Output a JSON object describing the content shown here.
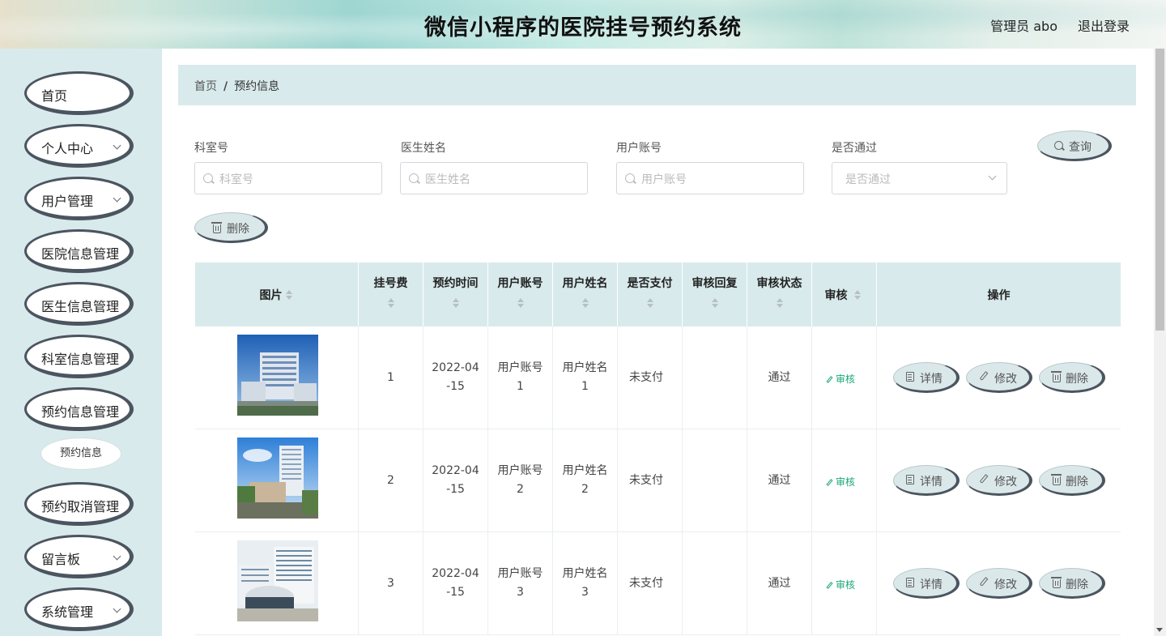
{
  "header": {
    "title": "微信小程序的医院挂号预约系统",
    "user": "管理员 abo",
    "logout": "退出登录"
  },
  "sidebar": {
    "items": [
      {
        "label": "首页",
        "has_arrow": false
      },
      {
        "label": "个人中心",
        "has_arrow": true
      },
      {
        "label": "用户管理",
        "has_arrow": true
      },
      {
        "label": "医院信息管理",
        "has_arrow": false
      },
      {
        "label": "医生信息管理",
        "has_arrow": false
      },
      {
        "label": "科室信息管理",
        "has_arrow": false
      },
      {
        "label": "预约信息管理",
        "has_arrow": false
      },
      {
        "label": "预约取消管理",
        "has_arrow": false
      },
      {
        "label": "留言板",
        "has_arrow": true
      },
      {
        "label": "系统管理",
        "has_arrow": true
      }
    ],
    "sub_item": "预约信息"
  },
  "breadcrumb": {
    "home": "首页",
    "separator": "/",
    "current": "预约信息"
  },
  "search": {
    "fields": [
      {
        "label": "科室号",
        "placeholder": "科室号"
      },
      {
        "label": "医生姓名",
        "placeholder": "医生姓名"
      },
      {
        "label": "用户账号",
        "placeholder": "用户账号"
      },
      {
        "label": "是否通过",
        "placeholder": "是否通过"
      }
    ],
    "query_button": "查询",
    "delete_button": "删除"
  },
  "table": {
    "headers": [
      "图片",
      "挂号费",
      "预约时间",
      "用户账号",
      "用户姓名",
      "是否支付",
      "审核回复",
      "审核状态",
      "审核",
      "操作"
    ],
    "rows": [
      {
        "fee": "1",
        "time_1": "2022-04",
        "time_2": "-15",
        "account_1": "用户账号",
        "account_2": "1",
        "name_1": "用户姓名",
        "name_2": "1",
        "paid": "未支付",
        "reply": "",
        "status": "通过",
        "audit": "审核"
      },
      {
        "fee": "2",
        "time_1": "2022-04",
        "time_2": "-15",
        "account_1": "用户账号",
        "account_2": "2",
        "name_1": "用户姓名",
        "name_2": "2",
        "paid": "未支付",
        "reply": "",
        "status": "通过",
        "audit": "审核"
      },
      {
        "fee": "3",
        "time_1": "2022-04",
        "time_2": "-15",
        "account_1": "用户账号",
        "account_2": "3",
        "name_1": "用户姓名",
        "name_2": "3",
        "paid": "未支付",
        "reply": "",
        "status": "通过",
        "audit": "审核"
      }
    ],
    "row_actions": [
      "详情",
      "修改",
      "删除"
    ]
  },
  "colors": {
    "sidebar_bg": "#d9eaec",
    "accent_green": "#1aa57a",
    "pill_border": "#4b5560"
  }
}
